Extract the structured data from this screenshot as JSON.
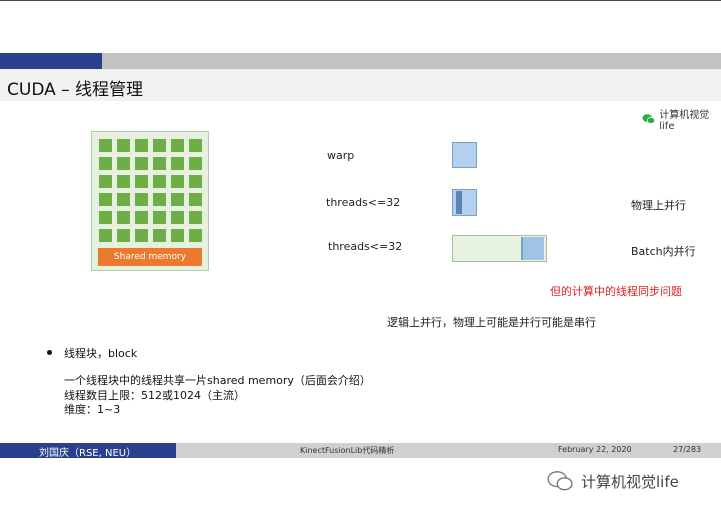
{
  "slide": {
    "title": "CUDA – 线程管理",
    "watermark_top": "计算机视觉life",
    "diagram": {
      "shared_memory": "Shared memory",
      "warp_label": "warp",
      "threads_label_1": "threads<=32",
      "threads_label_2": "threads<=32",
      "right_label_1": "物理上并行",
      "right_label_2": "Batch内并行",
      "red_note": "但的计算中的线程同步问题",
      "center_note": "逻辑上并行，物理上可能是并行可能是串行"
    },
    "bullet": {
      "text": "线程块，block",
      "lines": [
        "一个线程块中的线程共享一片shared memory（后面会介绍）",
        "线程数目上限：512或1024（主流）",
        "维度：1~3"
      ]
    },
    "footer": {
      "author": "刘国庆（RSE, NEU）",
      "talk": "KinectFusionLib代码精析",
      "date": "February 22, 2020",
      "page": "27/283"
    },
    "watermark_bottom": "计算机视觉life"
  },
  "colors": {
    "navy": "#2b3f8f",
    "green_cell": "#6fad47",
    "orange": "#ec7a2e",
    "blue_block": "#b3d1ee",
    "red_text": "#e02020"
  }
}
